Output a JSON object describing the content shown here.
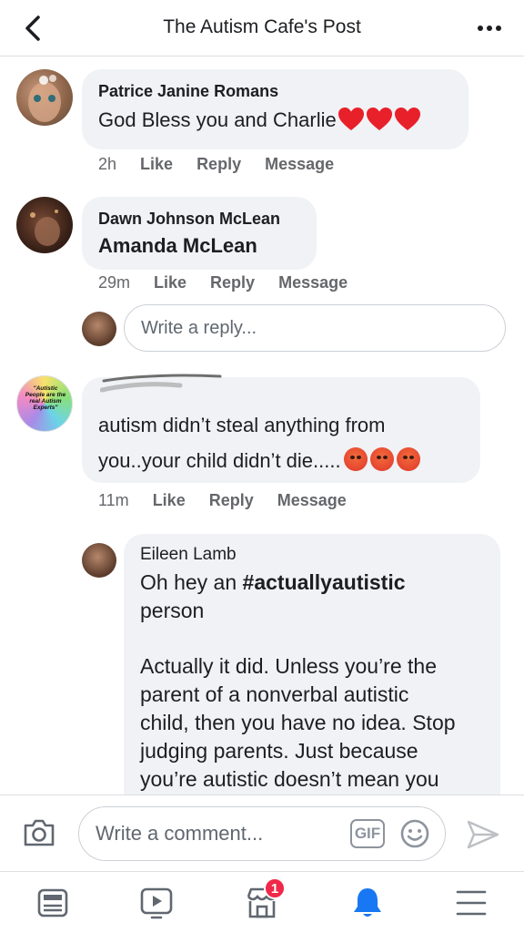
{
  "header": {
    "title": "The Autism Cafe's Post",
    "back_icon": "chevron-left-icon",
    "more_icon": "more-horizontal-icon"
  },
  "comments": [
    {
      "author": "Patrice Janine Romans",
      "text": "God Bless you and Charlie",
      "emoji": "heart",
      "emoji_count": 3,
      "time": "2h",
      "actions": [
        "Like",
        "Reply",
        "Message"
      ]
    },
    {
      "author": "Dawn Johnson McLean",
      "text": "Amanda McLean",
      "time": "29m",
      "actions": [
        "Like",
        "Reply",
        "Message"
      ]
    },
    {
      "author": "",
      "avatar_text": "\"Autistic People are the real Autism Experts\"",
      "text_line1": "autism didn’t steal anything from",
      "text_line2": "you..your child didn’t die.....",
      "emoji": "angry",
      "emoji_count": 3,
      "time": "11m",
      "actions": [
        "Like",
        "Reply",
        "Message"
      ]
    }
  ],
  "reply_box": {
    "placeholder": "Write a reply..."
  },
  "nested_reply": {
    "author": "Eileen Lamb",
    "line1_prefix": "Oh hey an ",
    "line1_bold": "#actuallyautistic",
    "line2": "person",
    "paragraph": [
      "Actually it did. Unless you’re the",
      "parent of a nonverbal autistic",
      "child, then you have no idea. Stop",
      "judging parents. Just because",
      "you’re autistic doesn’t mean you"
    ]
  },
  "composer": {
    "placeholder": "Write a comment...",
    "gif_label": "GIF",
    "camera_icon": "camera-icon",
    "emoji_icon": "smiley-icon",
    "send_icon": "send-icon"
  },
  "bottom_nav": {
    "items": [
      "news-feed-icon",
      "watch-icon",
      "marketplace-icon",
      "notifications-icon",
      "menu-icon"
    ],
    "marketplace_badge": "1",
    "active": "notifications-icon",
    "accent_color": "#1877f2"
  }
}
